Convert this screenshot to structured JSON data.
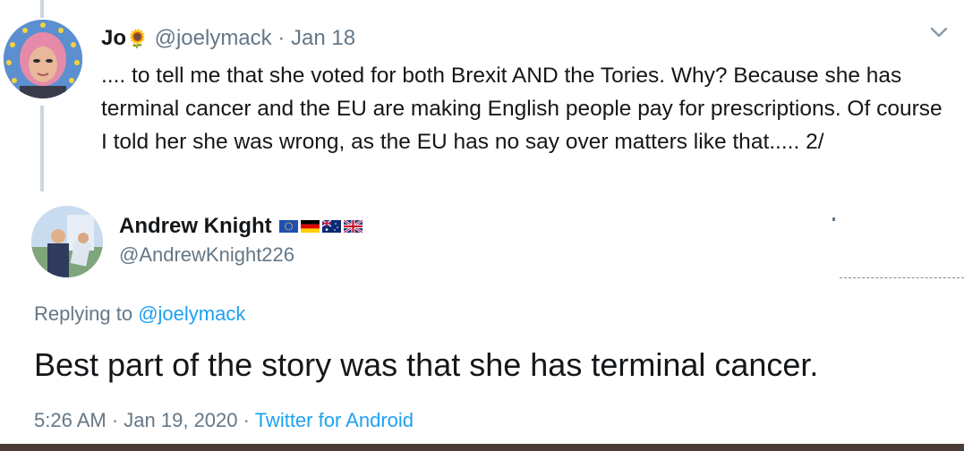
{
  "tweet1": {
    "name": "Jo",
    "emoji": "🌻",
    "handle": "@joelymack",
    "separator": "·",
    "date": "Jan 18",
    "text": ".... to tell me that she voted for both Brexit AND the Tories. Why? Because she has terminal cancer and the EU are making English people pay for prescriptions. Of course I told her she was wrong, as the EU has no say over matters like that..... 2/"
  },
  "tweet2": {
    "name": "Andrew Knight",
    "flags": [
      "eu-flag",
      "germany-flag",
      "australia-flag",
      "uk-flag"
    ],
    "handle": "@AndrewKnight226",
    "replying_prefix": "Replying to",
    "replying_to": "@joelymack",
    "text": "Best part of the story was that she has terminal cancer.",
    "time": "5:26 AM",
    "separator": "·",
    "date": "Jan 19, 2020",
    "separator2": "·",
    "source": "Twitter for Android"
  },
  "colors": {
    "text": "#14171a",
    "muted": "#657786",
    "link": "#1da1f2",
    "thread_line": "#ccd6dd"
  }
}
